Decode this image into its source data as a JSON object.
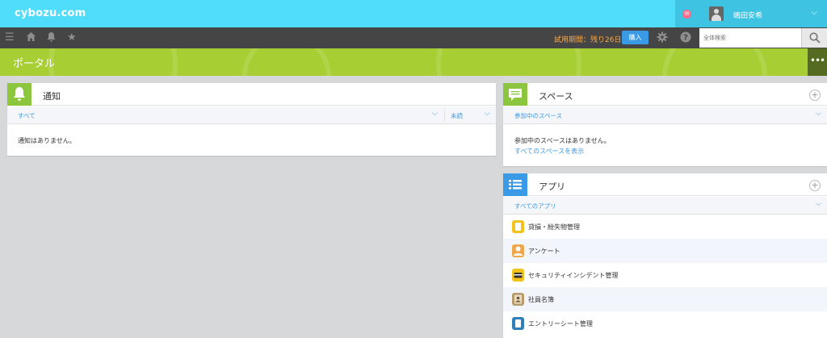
{
  "header": {
    "logo": "cybozu.com",
    "user_name": "嶋田安希"
  },
  "toolbar": {
    "trial": "試用期間：残り26日",
    "buy": "購入",
    "search_placeholder": "全体検索"
  },
  "portal": {
    "title": "ポータル",
    "more": "•••"
  },
  "notifications": {
    "title": "通知",
    "filter_all": "すべて",
    "filter_status": "未読",
    "empty": "通知はありません。"
  },
  "spaces": {
    "title": "スペース",
    "filter": "参加中のスペース",
    "empty": "参加中のスペースはありません。",
    "show_all": "すべてのスペースを表示"
  },
  "apps": {
    "title": "アプリ",
    "filter": "すべてのアプリ",
    "items": [
      {
        "label": "貸損・紛失物管理",
        "color": "#f3c31b"
      },
      {
        "label": "アンケート",
        "color": "#f0a64d"
      },
      {
        "label": "セキュリティインシデント管理",
        "color": "#f3c31b"
      },
      {
        "label": "社員名簿",
        "color": "#b79a6a"
      },
      {
        "label": "エントリーシート管理",
        "color": "#2f7fb8"
      }
    ]
  },
  "colors": {
    "header": "#50dcfb",
    "toolbar": "#454545",
    "portal_band": "#a7ce33",
    "link": "#3a9ae6",
    "trial": "#f6a94e"
  }
}
